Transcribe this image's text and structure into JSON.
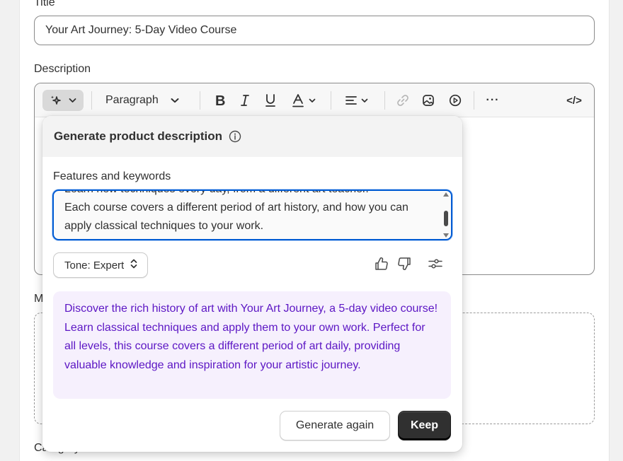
{
  "form": {
    "title_label": "Title",
    "title_value": "Your Art Journey: 5-Day Video Course",
    "description_label": "Description",
    "media_label_partial": "M",
    "category_label": "Category"
  },
  "toolbar": {
    "paragraph_label": "Paragraph",
    "more_label": "···",
    "code_label": "</>"
  },
  "popover": {
    "title": "Generate product description",
    "features_label": "Features and keywords",
    "features_text_hidden": "Learn new techniques every day, from a different art teacher.",
    "features_text": "Each course covers a different period of art history, and how you can apply classical techniques to your work.",
    "tone_label": "Tone: Expert",
    "result_text": "Discover the rich history of art with Your Art Journey, a 5-day video course! Learn classical techniques and apply them to your own work. Perfect for all levels, this course covers a different period of art daily, providing valuable knowledge and inspiration for your artistic journey.",
    "generate_again_label": "Generate again",
    "keep_label": "Keep"
  },
  "icons": {
    "ai": "sparkle-icon",
    "info": "info-icon",
    "thumbs_up": "thumbs-up-icon",
    "thumbs_down": "thumbs-down-icon",
    "settings": "sliders-icon"
  },
  "colors": {
    "accent": "#005bd3",
    "result_bg": "#f6f0fd",
    "result_text": "#5c16c4",
    "primary_button": "#303030"
  }
}
